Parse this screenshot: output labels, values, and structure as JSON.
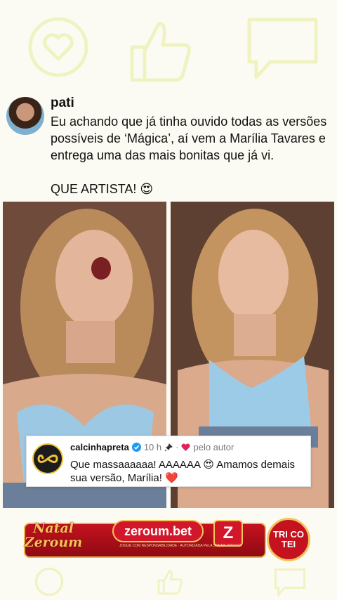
{
  "post": {
    "username": "pati",
    "paragraph1": "Eu achando que já tinha ouvido todas as versões possíveis de ‘Mágica’, aí vem a Marília Tavares e entrega uma das mais bonitas que já vi.",
    "paragraph2": "QUE ARTISTA! 😍"
  },
  "comment": {
    "username": "calcinhapreta",
    "time": "10 h",
    "author_label": "pelo autor",
    "text": "Que massaaaaaa! AAAAAA 😍 Amamos demais sua versão, Marília! ❤️"
  },
  "banner": {
    "natal_text": "Natal Zeroum",
    "brand": "zeroum.bet",
    "logo_letter": "Z",
    "disclaimer": "JOGUE COM RESPONSABILIDADE · AUTORIZADA PELA SPA/MF 000/2024",
    "tricotei": "TRI CO TEI"
  },
  "colors": {
    "brand_red": "#c4121f",
    "gold": "#f2c45a",
    "verified": "#1d9bf0",
    "heart": "#e0245e"
  },
  "icons": [
    "heart-icon",
    "like-icon",
    "comment-icon",
    "verified-icon",
    "pin-icon"
  ]
}
